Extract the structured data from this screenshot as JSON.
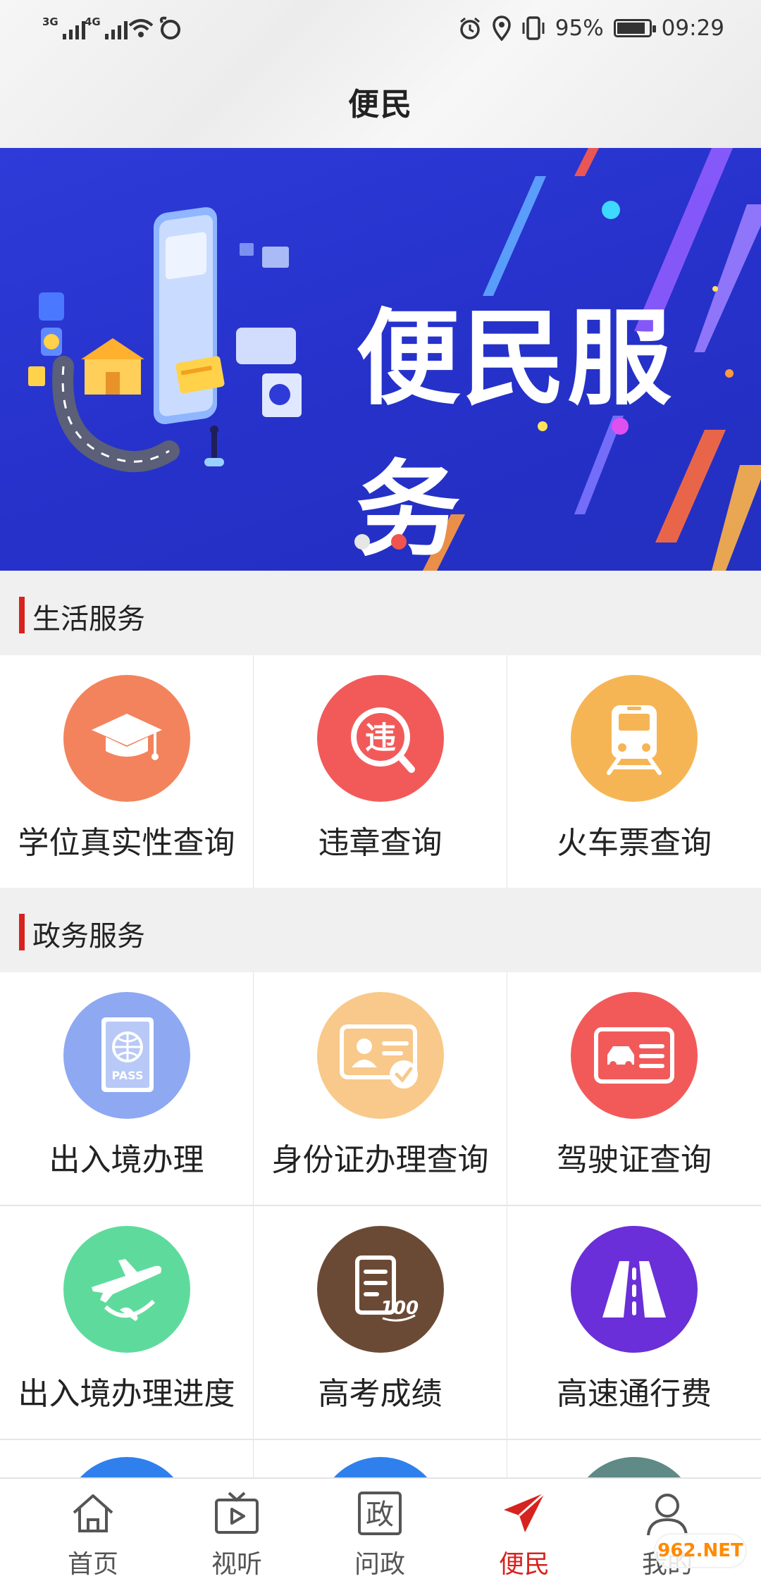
{
  "status_bar": {
    "signal1_label": "3G",
    "signal2_label": "4G",
    "battery_percent": "95%",
    "time": "09:29"
  },
  "header": {
    "title": "便民"
  },
  "banner": {
    "title": "便民服务",
    "slide_count": 2,
    "active_slide": 2,
    "background_color": "#2c38d0"
  },
  "sections": [
    {
      "title": "生活服务",
      "items": [
        {
          "label": "学位真实性查询",
          "icon": "graduation-cap-icon",
          "color": "#f3835c"
        },
        {
          "label": "违章查询",
          "icon": "violation-search-icon",
          "color": "#f25a5a"
        },
        {
          "label": "火车票查询",
          "icon": "train-icon",
          "color": "#f6b555"
        }
      ]
    },
    {
      "title": "政务服务",
      "items": [
        {
          "label": "出入境办理",
          "icon": "passport-icon",
          "color": "#8ea8f2"
        },
        {
          "label": "身份证办理查询",
          "icon": "id-card-icon",
          "color": "#f8c98a"
        },
        {
          "label": "驾驶证查询",
          "icon": "driver-license-icon",
          "color": "#f25a5a"
        },
        {
          "label": "出入境办理进度",
          "icon": "airplane-globe-icon",
          "color": "#5edb9c"
        },
        {
          "label": "高考成绩",
          "icon": "exam-score-icon",
          "color": "#6b4a35"
        },
        {
          "label": "高速通行费",
          "icon": "highway-icon",
          "color": "#6a2fd8"
        }
      ]
    }
  ],
  "tabbar": {
    "tabs": [
      {
        "label": "首页",
        "icon": "home-icon",
        "active": false
      },
      {
        "label": "视听",
        "icon": "tv-play-icon",
        "active": false
      },
      {
        "label": "问政",
        "icon": "politics-icon",
        "icon_text": "政",
        "active": false
      },
      {
        "label": "便民",
        "icon": "paper-plane-icon",
        "active": true
      },
      {
        "label": "我的",
        "icon": "user-icon",
        "active": false
      }
    ],
    "active_color": "#d6231f"
  },
  "watermark": {
    "text": "962.NET"
  }
}
